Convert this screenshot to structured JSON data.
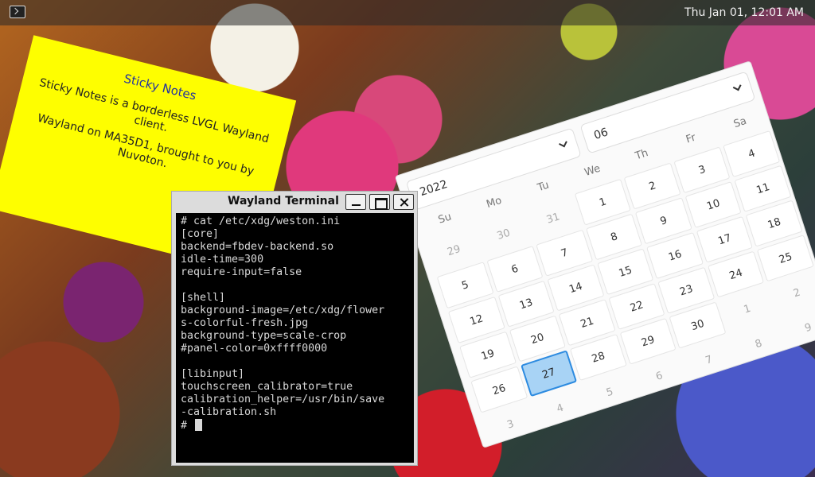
{
  "panel": {
    "clock": "Thu Jan 01, 12:01 AM",
    "launcher_icon": "terminal-icon"
  },
  "sticky": {
    "title": "Sticky Notes",
    "para1": "Sticky Notes is a borderless LVGL Wayland client.",
    "para2": "Wayland on MA35D1, brought to you by Nuvoton."
  },
  "terminal": {
    "title": "Wayland Terminal",
    "lines": [
      "# cat /etc/xdg/weston.ini",
      "[core]",
      "backend=fbdev-backend.so",
      "idle-time=300",
      "require-input=false",
      "",
      "[shell]",
      "background-image=/etc/xdg/flower",
      "s-colorful-fresh.jpg",
      "background-type=scale-crop",
      "#panel-color=0xffff0000",
      "",
      "[libinput]",
      "touchscreen_calibrator=true",
      "calibration_helper=/usr/bin/save",
      "-calibration.sh",
      "# "
    ]
  },
  "calendar": {
    "year": "2022",
    "month": "06",
    "weekdays": [
      "Su",
      "Mo",
      "Tu",
      "We",
      "Th",
      "Fr",
      "Sa"
    ],
    "days": [
      {
        "label": "29",
        "current": false
      },
      {
        "label": "30",
        "current": false
      },
      {
        "label": "31",
        "current": false
      },
      {
        "label": "1",
        "current": true
      },
      {
        "label": "2",
        "current": true
      },
      {
        "label": "3",
        "current": true
      },
      {
        "label": "4",
        "current": true
      },
      {
        "label": "5",
        "current": true
      },
      {
        "label": "6",
        "current": true
      },
      {
        "label": "7",
        "current": true
      },
      {
        "label": "8",
        "current": true
      },
      {
        "label": "9",
        "current": true
      },
      {
        "label": "10",
        "current": true
      },
      {
        "label": "11",
        "current": true
      },
      {
        "label": "12",
        "current": true
      },
      {
        "label": "13",
        "current": true
      },
      {
        "label": "14",
        "current": true
      },
      {
        "label": "15",
        "current": true
      },
      {
        "label": "16",
        "current": true
      },
      {
        "label": "17",
        "current": true
      },
      {
        "label": "18",
        "current": true
      },
      {
        "label": "19",
        "current": true
      },
      {
        "label": "20",
        "current": true
      },
      {
        "label": "21",
        "current": true
      },
      {
        "label": "22",
        "current": true
      },
      {
        "label": "23",
        "current": true
      },
      {
        "label": "24",
        "current": true
      },
      {
        "label": "25",
        "current": true
      },
      {
        "label": "26",
        "current": true
      },
      {
        "label": "27",
        "current": true,
        "selected": true
      },
      {
        "label": "28",
        "current": true
      },
      {
        "label": "29",
        "current": true
      },
      {
        "label": "30",
        "current": true
      },
      {
        "label": "1",
        "current": false
      },
      {
        "label": "2",
        "current": false
      },
      {
        "label": "3",
        "current": false
      },
      {
        "label": "4",
        "current": false
      },
      {
        "label": "5",
        "current": false
      },
      {
        "label": "6",
        "current": false
      },
      {
        "label": "7",
        "current": false
      },
      {
        "label": "8",
        "current": false
      },
      {
        "label": "9",
        "current": false
      }
    ],
    "selected_color": "#a8d3f5",
    "selected_border": "#2d8be0"
  }
}
